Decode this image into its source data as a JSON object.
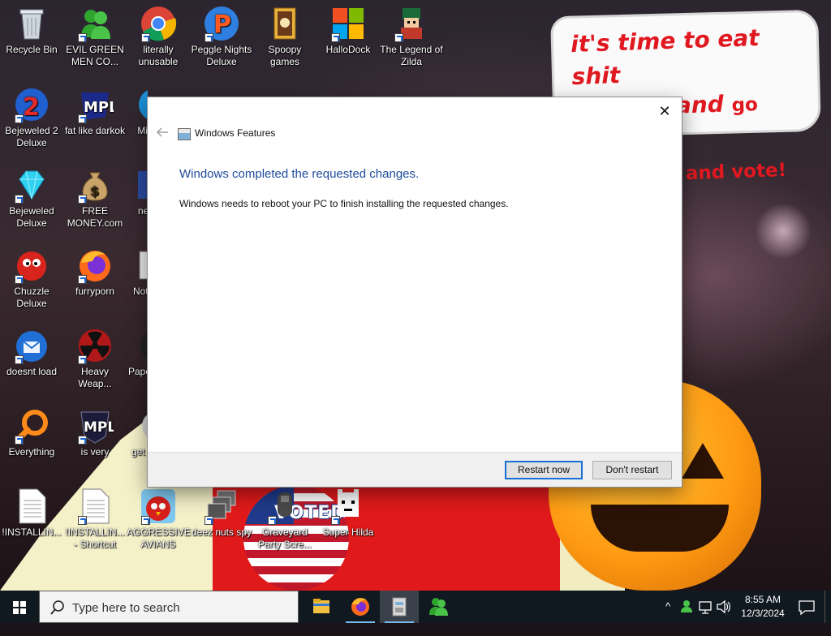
{
  "wallpaper": {
    "speech_bubble": {
      "line1": "it's time to eat shit",
      "line2_a": "and die and ",
      "line2_b": "go trick",
      "line3": "and vote!"
    },
    "flag_text": "VOTED"
  },
  "desktop_icons": [
    {
      "label": "Recycle Bin",
      "icon": "recycle-bin-icon"
    },
    {
      "label": "EVIL GREEN MEN CO...",
      "icon": "green-people-icon"
    },
    {
      "label": "literally unusable",
      "icon": "chrome-icon"
    },
    {
      "label": "Peggle Nights Deluxe",
      "icon": "peggle-icon"
    },
    {
      "label": "Spoopy games",
      "icon": "folder-icon"
    },
    {
      "label": "HalloDock",
      "icon": "windows-logo-icon"
    },
    {
      "label": "The Legend of Zilda",
      "icon": "zelda-icon"
    },
    {
      "label": "Bejeweled 2 Deluxe",
      "icon": "bejeweled2-icon"
    },
    {
      "label": "fat like darkok",
      "icon": "mpl-icon"
    },
    {
      "label": "Mi",
      "icon": "app-icon"
    },
    {
      "label": "Bejeweled Deluxe",
      "icon": "diamond-icon"
    },
    {
      "label": "FREE MONEY.com",
      "icon": "money-bag-icon"
    },
    {
      "label": "ne",
      "icon": "app-icon"
    },
    {
      "label": "Chuzzle Deluxe",
      "icon": "chuzzle-icon"
    },
    {
      "label": "furryporn",
      "icon": "firefox-icon"
    },
    {
      "label": "Not",
      "icon": "notepad-icon"
    },
    {
      "label": "doesnt load",
      "icon": "thunderbird-icon"
    },
    {
      "label": "Heavy Weap...",
      "icon": "radiation-icon"
    },
    {
      "label": "Pape",
      "icon": "app-icon"
    },
    {
      "label": "Everything",
      "icon": "everything-search-icon"
    },
    {
      "label": "is very",
      "icon": "mpl-icon"
    },
    {
      "label": "get",
      "icon": "app-icon"
    },
    {
      "label": "!INSTALLIN...",
      "icon": "document-icon"
    },
    {
      "label": "!INSTALLIN... - Shortcut",
      "icon": "document-icon"
    },
    {
      "label": "AGGRESSIVE AVIANS",
      "icon": "angry-bird-icon"
    },
    {
      "label": "deez nuts spy",
      "icon": "windows-stack-icon"
    },
    {
      "label": "Graveyard Party Scre...",
      "icon": "graveyard-icon"
    },
    {
      "label": "Super Hilda",
      "icon": "pixel-cat-icon"
    }
  ],
  "dialog": {
    "back_icon": "back-arrow-icon",
    "title": "Windows Features",
    "heading": "Windows completed the requested changes.",
    "body": "Windows needs to reboot your PC to finish installing the requested changes.",
    "close_glyph": "✕",
    "buttons": {
      "restart": "Restart now",
      "dont_restart": "Don't restart"
    }
  },
  "taskbar": {
    "search_placeholder": "Type here to search",
    "apps": [
      {
        "name": "File Explorer",
        "icon": "folder-icon"
      },
      {
        "name": "Firefox",
        "icon": "firefox-icon"
      },
      {
        "name": "Windows Features",
        "icon": "windows-features-icon"
      },
      {
        "name": "Green People",
        "icon": "green-people-icon"
      }
    ],
    "tray": {
      "overflow_glyph": "^",
      "time": "8:55 AM",
      "date": "12/3/2024"
    }
  },
  "colors": {
    "dialog_heading": "#1e4a9a",
    "taskbar_bg": "#101820",
    "button_focus_border": "#1a6fd4",
    "bubble_text": "#e01820"
  }
}
